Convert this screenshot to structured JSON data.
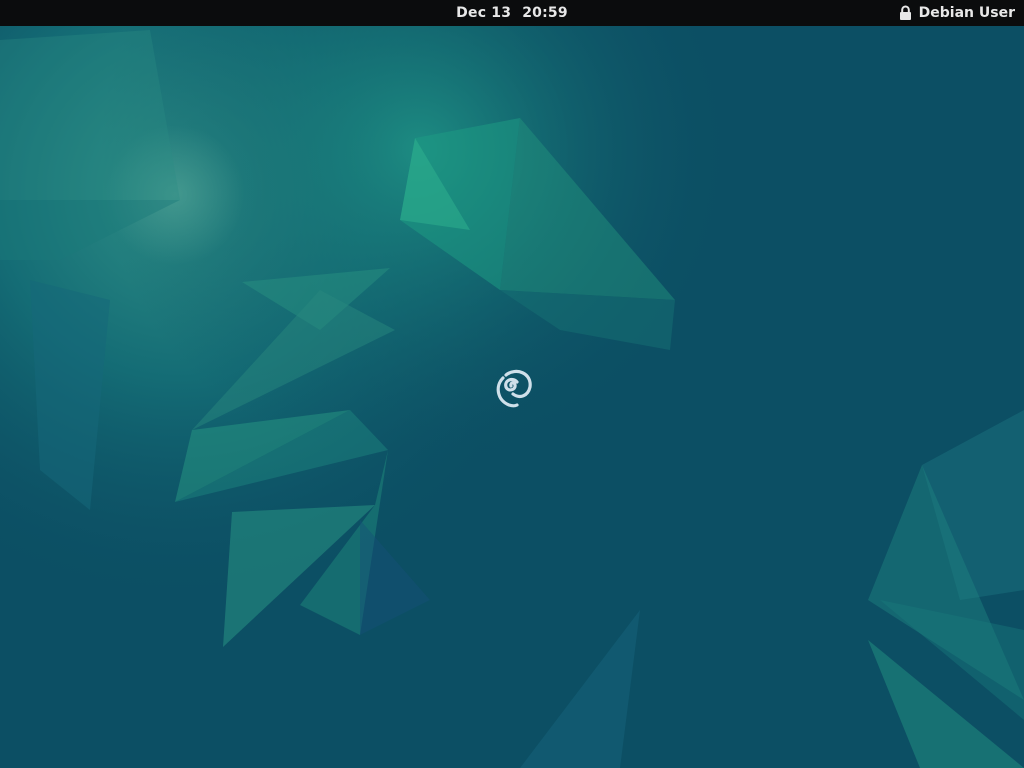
{
  "topbar": {
    "date": "Dec 13",
    "time": "20:59",
    "user": "Debian User",
    "lock_icon": "lock-icon"
  },
  "desktop": {
    "logo_icon": "debian-swirl-icon",
    "background_color": "#0c4f64",
    "accent_color": "#1f9b84"
  }
}
